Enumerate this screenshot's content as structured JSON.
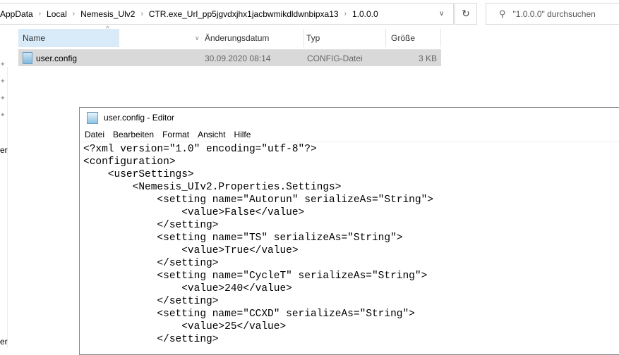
{
  "explorer": {
    "breadcrumb": [
      "AppData",
      "Local",
      "Nemesis_Ulv2",
      "CTR.exe_Url_pp5jgvdxjhx1jacbwmikdldwnbipxa13",
      "1.0.0.0"
    ],
    "search_placeholder": "\"1.0.0.0\" durchsuchen",
    "columns": {
      "name": "Name",
      "date": "Änderungsdatum",
      "type": "Typ",
      "size": "Größe"
    },
    "files": [
      {
        "name": "user.config",
        "date": "30.09.2020 08:14",
        "type": "CONFIG-Datei",
        "size": "3 KB"
      }
    ],
    "sidebar_fragments": [
      "er",
      "er"
    ]
  },
  "editor": {
    "title": "user.config - Editor",
    "menu": [
      "Datei",
      "Bearbeiten",
      "Format",
      "Ansicht",
      "Hilfe"
    ],
    "lines": [
      "<?xml version=\"1.0\" encoding=\"utf-8\"?>",
      "<configuration>",
      "    <userSettings>",
      "        <Nemesis_UIv2.Properties.Settings>",
      "            <setting name=\"Autorun\" serializeAs=\"String\">",
      "                <value>False</value>",
      "            </setting>",
      "            <setting name=\"TS\" serializeAs=\"String\">",
      "                <value>True</value>",
      "            </setting>",
      "            <setting name=\"CycleT\" serializeAs=\"String\">",
      "                <value>240</value>",
      "            </setting>",
      "            <setting name=\"CCXD\" serializeAs=\"String\">",
      "                <value>25</value>",
      "            </setting>"
    ]
  }
}
